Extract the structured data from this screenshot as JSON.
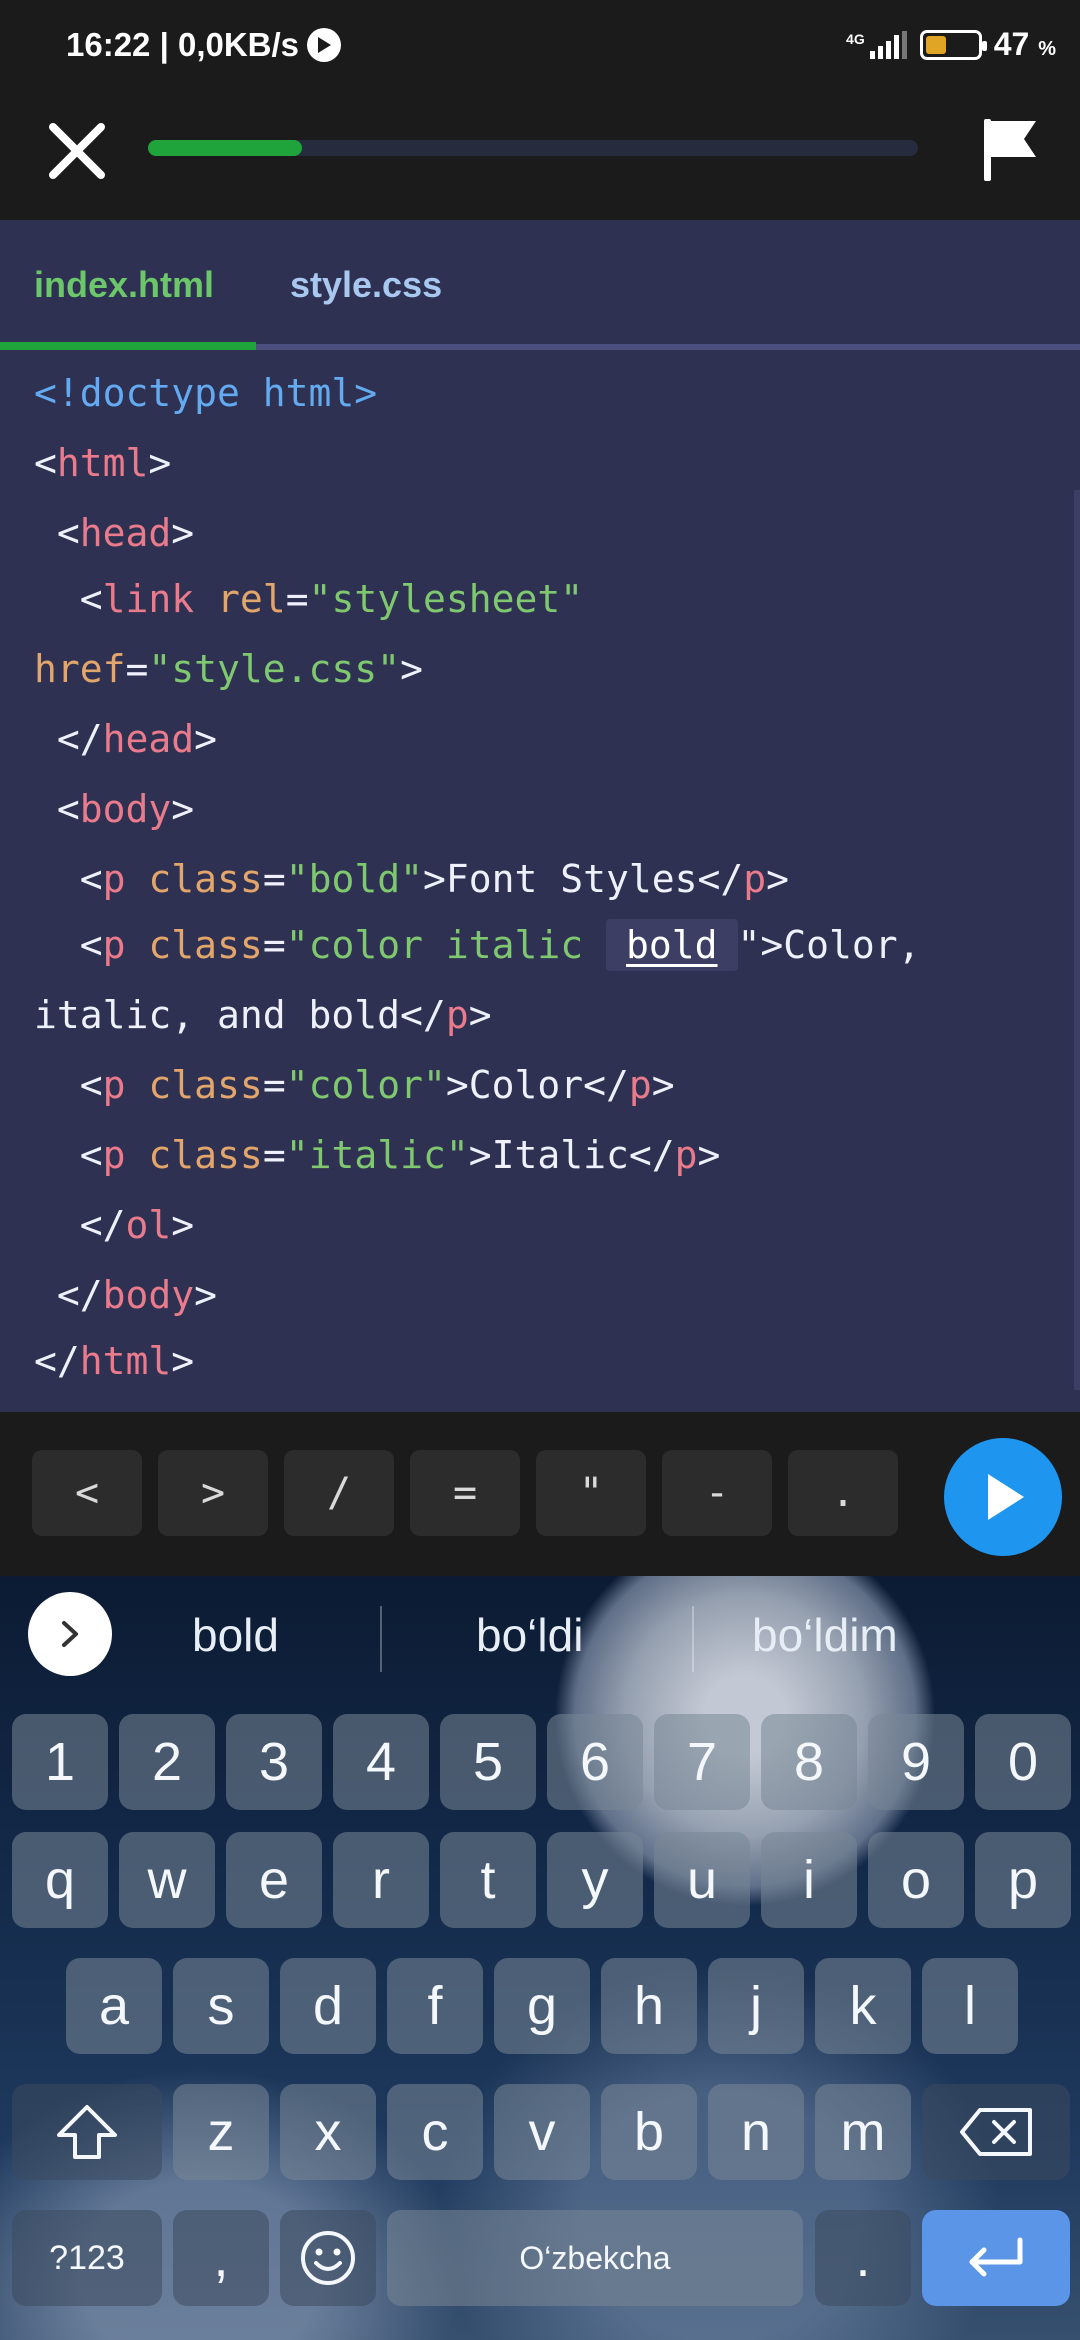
{
  "status_bar": {
    "time_speed": "16:22 | 0,0KB/s",
    "network": "4G",
    "battery_percent": "47",
    "battery_unit": "%",
    "battery_level": 0.47
  },
  "top_bar": {
    "lesson_progress": 0.2
  },
  "editor": {
    "tabs": [
      {
        "label": "index.html",
        "active": true
      },
      {
        "label": "style.css",
        "active": false
      }
    ],
    "code": {
      "l1": "<!doctype html>",
      "l2_open": "<",
      "l2_tag": "html",
      "l2_close": ">",
      "l3_open": " <",
      "l3_tag": "head",
      "l3_close": ">",
      "l4_open": "  <",
      "l4_tag": "link",
      "l4_sp": " ",
      "l4_attr": "rel",
      "l4_eq": "=",
      "l4_val": "\"stylesheet\"",
      "l5_attr": "href",
      "l5_eq": "=",
      "l5_val": "\"style.css\"",
      "l5_close": ">",
      "l6_open": " </",
      "l6_tag": "head",
      "l6_close": ">",
      "l7_open": " <",
      "l7_tag": "body",
      "l7_close": ">",
      "l8_open": "  <",
      "l8_tag": "p",
      "l8_sp": " ",
      "l8_attr": "class",
      "l8_eq": "=",
      "l8_val": "\"bold\"",
      "l8_text": ">Font Styles</",
      "l8_tag2": "p",
      "l8_close": ">",
      "l9_open": "  <",
      "l9_tag": "p",
      "l9_sp": " ",
      "l9_attr": "class",
      "l9_eq": "=",
      "l9_val": "\"color italic ",
      "l9_hl": "bold",
      "l9_text": "\">Color,",
      "l10_text": "italic, and bold</",
      "l10_tag": "p",
      "l10_close": ">",
      "l11_open": "  <",
      "l11_tag": "p",
      "l11_sp": " ",
      "l11_attr": "class",
      "l11_eq": "=",
      "l11_val": "\"color\"",
      "l11_text": ">Color</",
      "l11_tag2": "p",
      "l11_close": ">",
      "l12_open": "  <",
      "l12_tag": "p",
      "l12_sp": " ",
      "l12_attr": "class",
      "l12_eq": "=",
      "l12_val": "\"italic\"",
      "l12_text": ">Italic</",
      "l12_tag2": "p",
      "l12_close": ">",
      "l13_open": "  </",
      "l13_tag": "ol",
      "l13_close": ">",
      "l14_open": " </",
      "l14_tag": "body",
      "l14_close": ">",
      "l15_open": "</",
      "l15_tag": "html",
      "l15_close": ">"
    }
  },
  "symbols": [
    "<",
    ">",
    "/",
    "=",
    "\"",
    "-",
    "."
  ],
  "keyboard": {
    "suggestions": [
      "bold",
      "bo‘ldi",
      "bo‘ldim"
    ],
    "numbers": [
      "1",
      "2",
      "3",
      "4",
      "5",
      "6",
      "7",
      "8",
      "9",
      "0"
    ],
    "row1": [
      "q",
      "w",
      "e",
      "r",
      "t",
      "y",
      "u",
      "i",
      "o",
      "p"
    ],
    "row2": [
      "a",
      "s",
      "d",
      "f",
      "g",
      "h",
      "j",
      "k",
      "l"
    ],
    "row3": [
      "z",
      "x",
      "c",
      "v",
      "b",
      "n",
      "m"
    ],
    "sym_key": "?123",
    "comma": ",",
    "space": "O‘zbekcha",
    "period": "."
  },
  "colors": {
    "accent_green": "#1fa43c",
    "run_blue": "#1e96f0",
    "editor_bg": "#2e3151"
  }
}
